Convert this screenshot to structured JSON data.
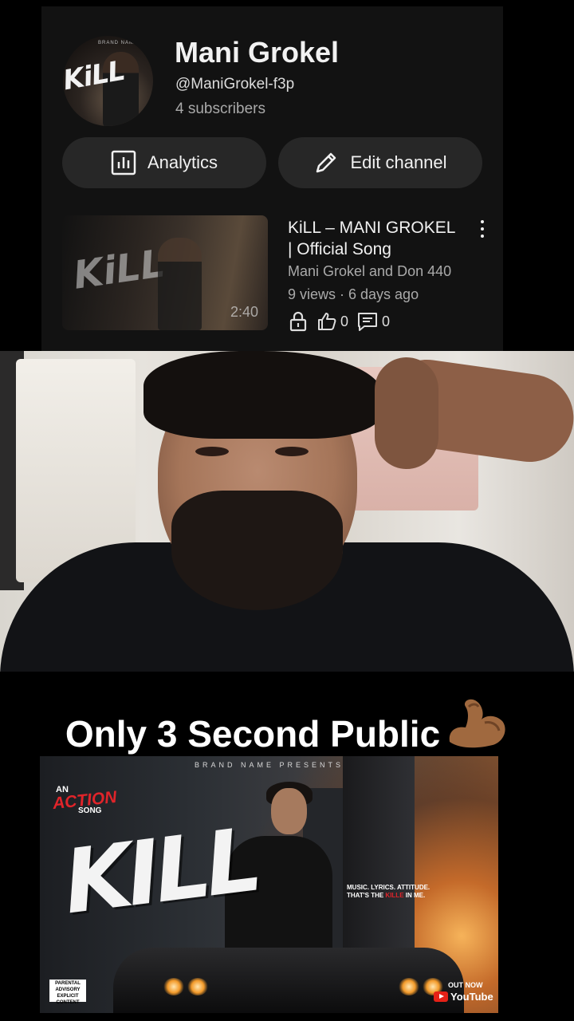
{
  "channel": {
    "name": "Mani Grokel",
    "handle": "@ManiGrokel-f3p",
    "subscribers": "4 subscribers",
    "avatar_text": "KiLL",
    "avatar_tag": "BRAND NAME"
  },
  "buttons": {
    "analytics_label": "Analytics",
    "edit_label": "Edit channel"
  },
  "video": {
    "thumb_text": "KiLL",
    "duration": "2:40",
    "title": "KiLL – MANI GROKEL | Official Song",
    "authors": "Mani Grokel  and Don 440",
    "stats": "9 views · 6 days ago",
    "likes": "0",
    "comments": "0",
    "visibility_icon": "lock-icon"
  },
  "caption": {
    "text": "Only 3 Second Public",
    "emoji": "flexed-biceps-emoji"
  },
  "poster": {
    "presents": "BRAND NAME PRESENTS",
    "an": "AN",
    "action": "ACTION",
    "song": "SONG",
    "title": "KILL",
    "tagline_1": "MUSIC. LYRICS. ATTITUDE.",
    "tagline_2a": "THAT'S THE ",
    "tagline_2b": "KILLE",
    "tagline_2c": " IN ME.",
    "advisory": "PARENTAL ADVISORY EXPLICIT CONTENT",
    "out_now": "OUT NOW",
    "platform": "YouTube"
  },
  "colors": {
    "card_bg": "#121212",
    "pill_bg": "#272727",
    "accent_red": "#e0242a"
  }
}
